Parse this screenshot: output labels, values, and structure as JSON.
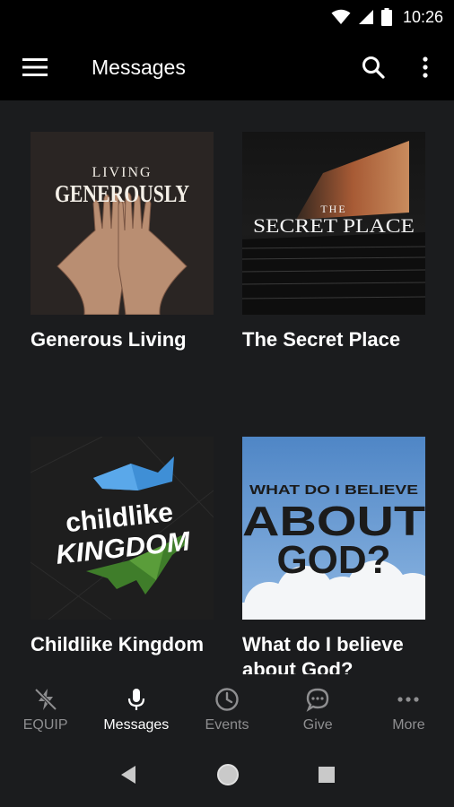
{
  "status_bar": {
    "time": "10:26"
  },
  "app_bar": {
    "title": "Messages"
  },
  "cards": [
    {
      "label": "Generous Living",
      "artwork_text": [
        "LIVING",
        "GENEROUSLY"
      ]
    },
    {
      "label": "The Secret Place",
      "artwork_text": [
        "THE",
        "SECRET PLACE"
      ]
    },
    {
      "label": "Childlike Kingdom",
      "artwork_text": [
        "childlike",
        "KINGDOM"
      ]
    },
    {
      "label": "What do I believe about God?",
      "artwork_text": [
        "WHAT DO I BELIEVE",
        "ABOUT",
        "GOD?"
      ]
    }
  ],
  "bottom_nav": [
    {
      "label": "EQUIP",
      "icon": "bolt-icon",
      "active": false
    },
    {
      "label": "Messages",
      "icon": "microphone-icon",
      "active": true
    },
    {
      "label": "Events",
      "icon": "clock-icon",
      "active": false
    },
    {
      "label": "Give",
      "icon": "chat-icon",
      "active": false
    },
    {
      "label": "More",
      "icon": "more-horizontal-icon",
      "active": false
    }
  ],
  "colors": {
    "background": "#000000",
    "content_bg": "#1b1c1e",
    "inactive": "#8e8e90",
    "active": "#ffffff"
  }
}
